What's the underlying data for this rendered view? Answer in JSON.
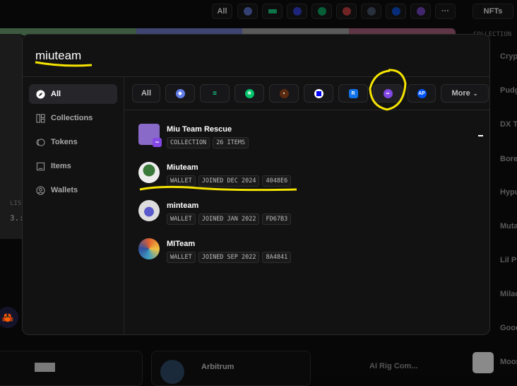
{
  "background": {
    "top_filters": {
      "all_label": "All",
      "chains": [
        "ethereum",
        "solana",
        "base",
        "flow",
        "avalanche",
        "zksync",
        "apechain",
        "polygon"
      ],
      "more_icon": "ellipsis",
      "nfts_label": "NFTs"
    },
    "collection_header": "COLLECTION",
    "right_list": [
      "Crypt",
      "Pudg",
      "DX Te",
      "Bore",
      "Hypu",
      "Muta",
      "Lil Pu",
      "Milac",
      "Good",
      "Moon"
    ],
    "left_stat": {
      "label": "LIS",
      "value": "3.:"
    },
    "bottom_cards": [
      {
        "name": "Arbitrum"
      },
      {
        "name": "AI Rig Com..."
      }
    ]
  },
  "search": {
    "query": "miuteam"
  },
  "sidebar": {
    "items": [
      {
        "label": "All",
        "icon": "compass-icon",
        "active": true
      },
      {
        "label": "Collections",
        "icon": "collections-icon"
      },
      {
        "label": "Tokens",
        "icon": "tokens-icon"
      },
      {
        "label": "Items",
        "icon": "image-icon"
      },
      {
        "label": "Wallets",
        "icon": "wallet-icon"
      }
    ]
  },
  "filters": {
    "all_label": "All",
    "more_label": "More",
    "chains": [
      {
        "name": "ethereum",
        "color": "#627eea"
      },
      {
        "name": "solana",
        "color": "#14f195"
      },
      {
        "name": "flow",
        "color": "#00c26a"
      },
      {
        "name": "b3",
        "color": "#5a2a10"
      },
      {
        "name": "base",
        "color": "#0000ff"
      },
      {
        "name": "ronin",
        "color": "#1273ea"
      },
      {
        "name": "polygon",
        "color": "#8247e5",
        "selected": true
      },
      {
        "name": "apechain",
        "color": "#0054fa"
      }
    ]
  },
  "results": [
    {
      "title": "Miu Team Rescue",
      "tags": [
        "COLLECTION",
        "26 ITEMS"
      ]
    },
    {
      "title": "Miuteam",
      "tags": [
        "WALLET",
        "JOINED DEC 2024",
        "4048E6"
      ]
    },
    {
      "title": "minteam",
      "tags": [
        "WALLET",
        "JOINED JAN 2022",
        "FD67B3"
      ]
    },
    {
      "title": "MITeam",
      "tags": [
        "WALLET",
        "JOINED SEP 2022",
        "8A4841"
      ]
    }
  ]
}
